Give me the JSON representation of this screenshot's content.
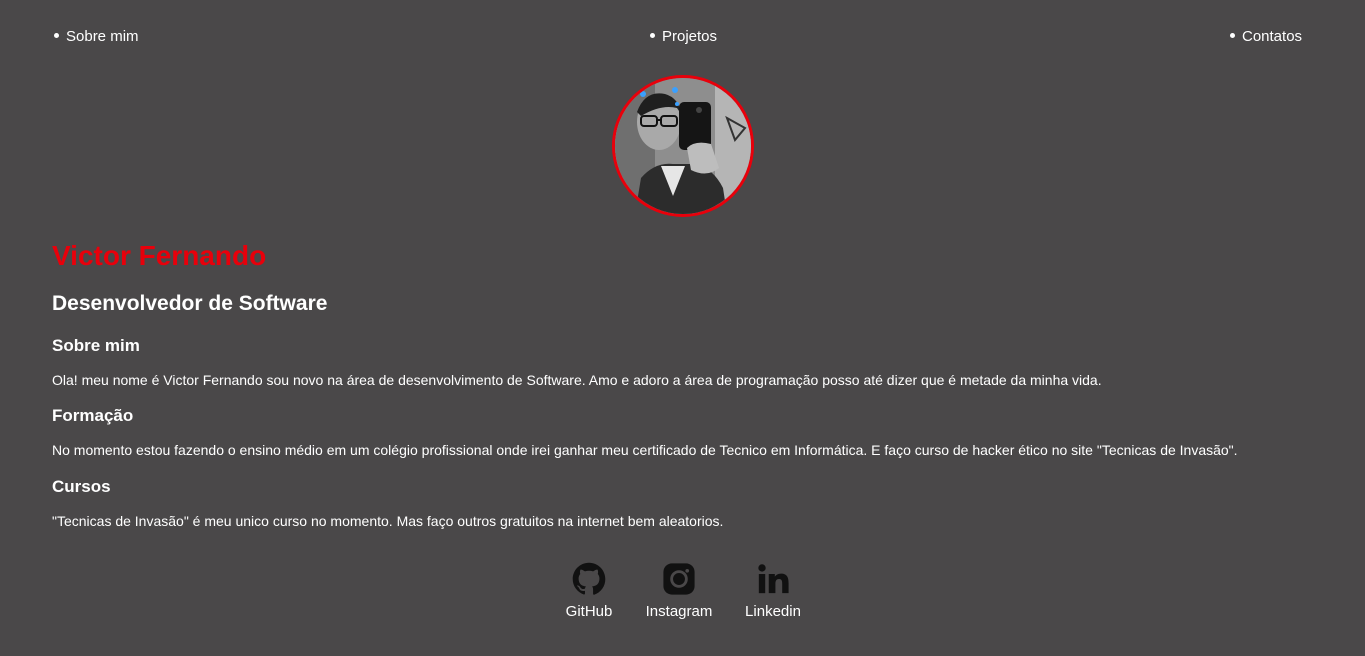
{
  "nav": {
    "items": [
      {
        "label": "Sobre mim"
      },
      {
        "label": "Projetos"
      },
      {
        "label": "Contatos"
      }
    ]
  },
  "profile": {
    "name": "Victor Fernando",
    "role": "Desenvolvedor de Software",
    "avatar_icon": "profile-photo",
    "name_color": "#e8000b",
    "avatar_border_color": "#e8000b"
  },
  "sections": [
    {
      "title": "Sobre mim",
      "text": "Ola! meu nome é Victor Fernando sou novo na área de desenvolvimento de Software. Amo e adoro a área de programação posso até dizer que é metade da minha vida."
    },
    {
      "title": "Formação",
      "text": "No momento estou fazendo o ensino médio em um colégio profissional onde irei ganhar meu certificado de Tecnico em Informática. E faço curso de hacker ético no site \"Tecnicas de Invasão\"."
    },
    {
      "title": "Cursos",
      "text": "\"Tecnicas de Invasão\" é meu unico curso no momento. Mas faço outros gratuitos na internet bem aleatorios."
    }
  ],
  "socials": [
    {
      "label": "GitHub",
      "icon": "github-icon"
    },
    {
      "label": "Instagram",
      "icon": "instagram-icon"
    },
    {
      "label": "Linkedin",
      "icon": "linkedin-icon"
    }
  ],
  "colors": {
    "background": "#4a4849",
    "text": "#ffffff",
    "accent": "#e8000b"
  }
}
